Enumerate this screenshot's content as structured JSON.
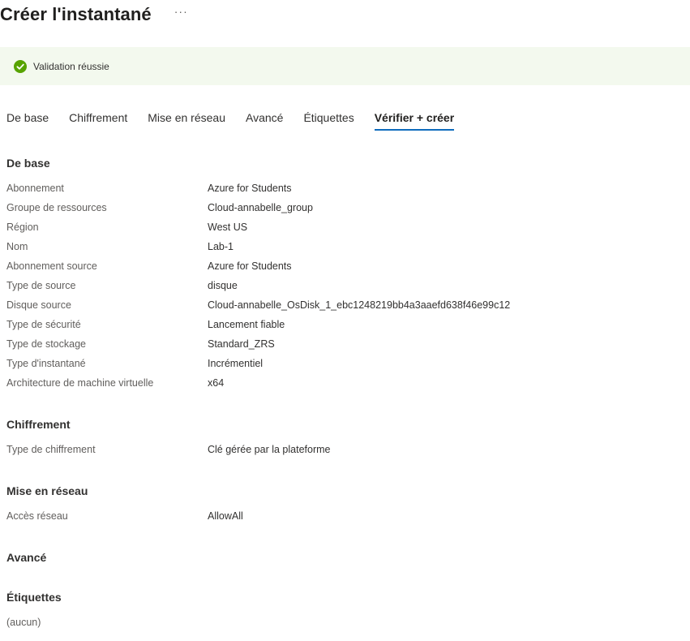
{
  "header": {
    "title": "Créer l'instantané",
    "more_label": "···"
  },
  "banner": {
    "message": "Validation réussie",
    "icon": "check-circle-icon",
    "color": "#57a300"
  },
  "tabs": [
    {
      "label": "De base",
      "active": false
    },
    {
      "label": "Chiffrement",
      "active": false
    },
    {
      "label": "Mise en réseau",
      "active": false
    },
    {
      "label": "Avancé",
      "active": false
    },
    {
      "label": "Étiquettes",
      "active": false
    },
    {
      "label": "Vérifier + créer",
      "active": true
    }
  ],
  "sections": {
    "basics": {
      "title": "De base",
      "rows": [
        {
          "label": "Abonnement",
          "value": "Azure for Students"
        },
        {
          "label": "Groupe de ressources",
          "value": "Cloud-annabelle_group"
        },
        {
          "label": "Région",
          "value": "West US"
        },
        {
          "label": "Nom",
          "value": "Lab-1"
        },
        {
          "label": "Abonnement source",
          "value": "Azure for Students"
        },
        {
          "label": "Type de source",
          "value": "disque"
        },
        {
          "label": "Disque source",
          "value": "Cloud-annabelle_OsDisk_1_ebc1248219bb4a3aaefd638f46e99c12"
        },
        {
          "label": "Type de sécurité",
          "value": "Lancement fiable"
        },
        {
          "label": "Type de stockage",
          "value": "Standard_ZRS"
        },
        {
          "label": "Type d'instantané",
          "value": "Incrémentiel"
        },
        {
          "label": "Architecture de machine virtuelle",
          "value": "x64"
        }
      ]
    },
    "encryption": {
      "title": "Chiffrement",
      "rows": [
        {
          "label": "Type de chiffrement",
          "value": "Clé gérée par la plateforme"
        }
      ]
    },
    "networking": {
      "title": "Mise en réseau",
      "rows": [
        {
          "label": "Accès réseau",
          "value": "AllowAll"
        }
      ]
    },
    "advanced": {
      "title": "Avancé"
    },
    "tags": {
      "title": "Étiquettes",
      "empty_text": "(aucun)"
    }
  },
  "colors": {
    "accent": "#0f6cbd",
    "banner_bg": "#f3f9ee",
    "success": "#57a300"
  }
}
